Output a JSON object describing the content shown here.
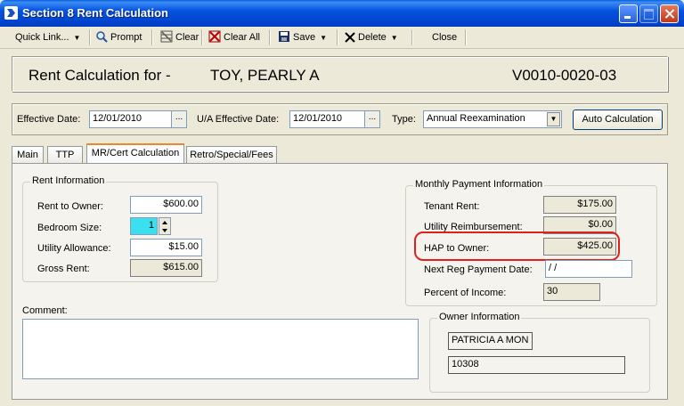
{
  "window": {
    "title": "Section 8 Rent Calculation"
  },
  "toolbar": {
    "quick_link": "Quick Link...",
    "prompt": "Prompt",
    "clear": "Clear",
    "clear_all": "Clear All",
    "save": "Save",
    "delete": "Delete",
    "close": "Close"
  },
  "header": {
    "label": "Rent Calculation for -",
    "tenant_name": "TOY, PEARLY A",
    "tenant_id": "V0010-0020-03"
  },
  "effective": {
    "effective_date_label": "Effective Date:",
    "effective_date": "12/01/2010",
    "ua_date_label": "U/A Effective Date:",
    "ua_date": "12/01/2010",
    "type_label": "Type:",
    "type_value": "Annual Reexamination",
    "auto_calc": "Auto Calculation"
  },
  "tabs": [
    "Main",
    "TTP",
    "MR/Cert Calculation",
    "Retro/Special/Fees"
  ],
  "rent_info": {
    "title": "Rent Information",
    "rent_to_owner_label": "Rent to Owner:",
    "rent_to_owner": "$600.00",
    "bedroom_size_label": "Bedroom Size:",
    "bedroom_size": "1",
    "utility_allowance_label": "Utility Allowance:",
    "utility_allowance": "$15.00",
    "gross_rent_label": "Gross Rent:",
    "gross_rent": "$615.00"
  },
  "monthly_payment": {
    "title": "Monthly Payment Information",
    "tenant_rent_label": "Tenant Rent:",
    "tenant_rent": "$175.00",
    "utility_reimb_label": "Utility Reimbursement:",
    "utility_reimb": "$0.00",
    "hap_label": "HAP to Owner:",
    "hap": "$425.00",
    "next_reg_label": "Next Reg Payment Date:",
    "next_reg": " / /",
    "percent_income_label": "Percent of Income:",
    "percent_income": "30"
  },
  "comment": {
    "label": "Comment:"
  },
  "owner_info": {
    "title": "Owner Information",
    "name": "PATRICIA A MON",
    "id": "10308"
  }
}
